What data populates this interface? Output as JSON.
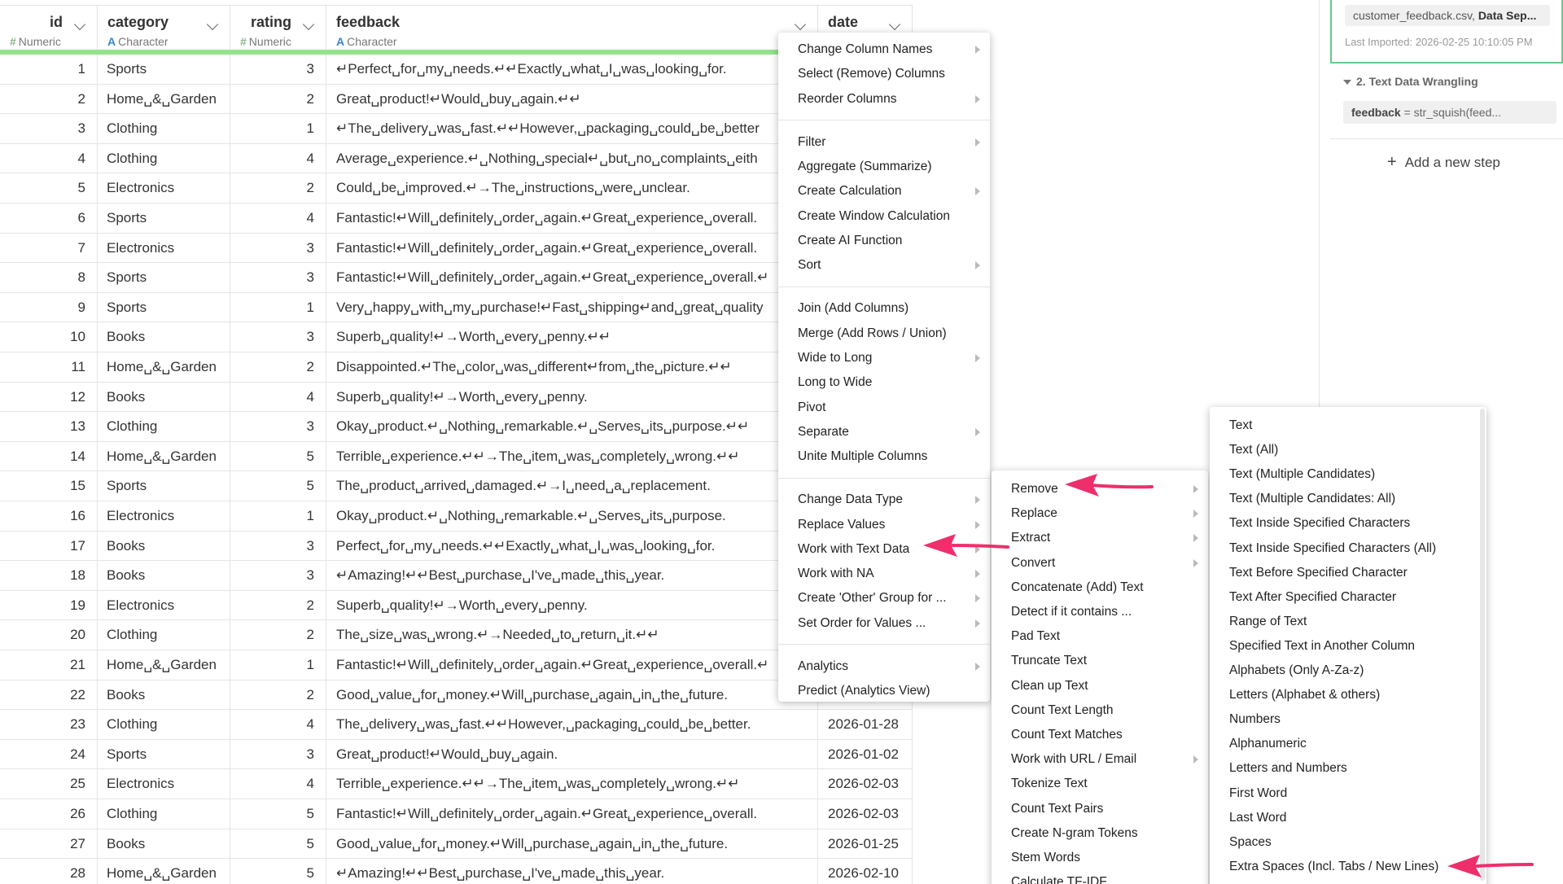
{
  "grid": {
    "columns": [
      {
        "name": "id",
        "type": "Numeric",
        "symbol": "#"
      },
      {
        "name": "category",
        "type": "Character",
        "symbol": "A"
      },
      {
        "name": "rating",
        "type": "Numeric",
        "symbol": "#"
      },
      {
        "name": "feedback",
        "type": "Character",
        "symbol": "A"
      },
      {
        "name": "date",
        "type": "",
        "symbol": ""
      }
    ],
    "rows": [
      {
        "id": "1",
        "category": "Sports",
        "rating": "3",
        "feedback": "↵Perfect␣for␣my␣needs.↵↵Exactly␣what␣I␣was␣looking␣for.",
        "date": ""
      },
      {
        "id": "2",
        "category": "Home␣&␣Garden",
        "rating": "2",
        "feedback": "Great␣product!↵Would␣buy␣again.↵↵",
        "date": ""
      },
      {
        "id": "3",
        "category": "Clothing",
        "rating": "1",
        "feedback": "↵The␣delivery␣was␣fast.↵↵However,␣packaging␣could␣be␣better",
        "date": ""
      },
      {
        "id": "4",
        "category": "Clothing",
        "rating": "4",
        "feedback": "Average␣experience.↵␣Nothing␣special↵␣but␣no␣complaints␣eith",
        "date": ""
      },
      {
        "id": "5",
        "category": "Electronics",
        "rating": "2",
        "feedback": "Could␣be␣improved.↵→The␣instructions␣were␣unclear.",
        "date": ""
      },
      {
        "id": "6",
        "category": "Sports",
        "rating": "4",
        "feedback": "Fantastic!↵Will␣definitely␣order␣again.↵Great␣experience␣overall.",
        "date": ""
      },
      {
        "id": "7",
        "category": "Electronics",
        "rating": "3",
        "feedback": "Fantastic!↵Will␣definitely␣order␣again.↵Great␣experience␣overall.",
        "date": ""
      },
      {
        "id": "8",
        "category": "Sports",
        "rating": "3",
        "feedback": "Fantastic!↵Will␣definitely␣order␣again.↵Great␣experience␣overall.↵",
        "date": ""
      },
      {
        "id": "9",
        "category": "Sports",
        "rating": "1",
        "feedback": "Very␣happy␣with␣my␣purchase!↵Fast␣shipping↵and␣great␣quality",
        "date": ""
      },
      {
        "id": "10",
        "category": "Books",
        "rating": "3",
        "feedback": "Superb␣quality!↵→Worth␣every␣penny.↵↵",
        "date": ""
      },
      {
        "id": "11",
        "category": "Home␣&␣Garden",
        "rating": "2",
        "feedback": "Disappointed.↵The␣color␣was␣different↵from␣the␣picture.↵↵",
        "date": ""
      },
      {
        "id": "12",
        "category": "Books",
        "rating": "4",
        "feedback": "Superb␣quality!↵→Worth␣every␣penny.",
        "date": ""
      },
      {
        "id": "13",
        "category": "Clothing",
        "rating": "3",
        "feedback": "Okay␣product.↵␣Nothing␣remarkable.↵␣Serves␣its␣purpose.↵↵",
        "date": ""
      },
      {
        "id": "14",
        "category": "Home␣&␣Garden",
        "rating": "5",
        "feedback": "Terrible␣experience.↵↵→The␣item␣was␣completely␣wrong.↵↵",
        "date": ""
      },
      {
        "id": "15",
        "category": "Sports",
        "rating": "5",
        "feedback": "The␣product␣arrived␣damaged.↵→I␣need␣a␣replacement.",
        "date": ""
      },
      {
        "id": "16",
        "category": "Electronics",
        "rating": "1",
        "feedback": "Okay␣product.↵␣Nothing␣remarkable.↵␣Serves␣its␣purpose.",
        "date": ""
      },
      {
        "id": "17",
        "category": "Books",
        "rating": "3",
        "feedback": "Perfect␣for␣my␣needs.↵↵Exactly␣what␣I␣was␣looking␣for.",
        "date": ""
      },
      {
        "id": "18",
        "category": "Books",
        "rating": "3",
        "feedback": "↵Amazing!↵↵Best␣purchase␣I've␣made␣this␣year.",
        "date": ""
      },
      {
        "id": "19",
        "category": "Electronics",
        "rating": "2",
        "feedback": "Superb␣quality!↵→Worth␣every␣penny.",
        "date": ""
      },
      {
        "id": "20",
        "category": "Clothing",
        "rating": "2",
        "feedback": "The␣size␣was␣wrong.↵→Needed␣to␣return␣it.↵↵",
        "date": ""
      },
      {
        "id": "21",
        "category": "Home␣&␣Garden",
        "rating": "1",
        "feedback": "Fantastic!↵Will␣definitely␣order␣again.↵Great␣experience␣overall.↵",
        "date": ""
      },
      {
        "id": "22",
        "category": "Books",
        "rating": "2",
        "feedback": "Good␣value␣for␣money.↵Will␣purchase␣again␣in␣the␣future.",
        "date": ""
      },
      {
        "id": "23",
        "category": "Clothing",
        "rating": "4",
        "feedback": "The␣delivery␣was␣fast.↵↵However,␣packaging␣could␣be␣better.",
        "date": "2026-01-28"
      },
      {
        "id": "24",
        "category": "Sports",
        "rating": "3",
        "feedback": "Great␣product!↵Would␣buy␣again.",
        "date": "2026-01-02"
      },
      {
        "id": "25",
        "category": "Electronics",
        "rating": "4",
        "feedback": "Terrible␣experience.↵↵→The␣item␣was␣completely␣wrong.↵↵",
        "date": "2026-02-03"
      },
      {
        "id": "26",
        "category": "Clothing",
        "rating": "5",
        "feedback": "Fantastic!↵Will␣definitely␣order␣again.↵Great␣experience␣overall.",
        "date": "2026-02-03"
      },
      {
        "id": "27",
        "category": "Books",
        "rating": "5",
        "feedback": "Good␣value␣for␣money.↵Will␣purchase␣again␣in␣the␣future.",
        "date": "2026-01-25"
      },
      {
        "id": "28",
        "category": "Home␣&␣Garden",
        "rating": "5",
        "feedback": "↵Amazing!↵↵Best␣purchase␣I've␣made␣this␣year.",
        "date": "2026-02-10"
      }
    ]
  },
  "panel": {
    "file_name": "customer_feedback.csv,",
    "file_suffix": "Data Sep...",
    "last_imported": "Last Imported: 2026-02-25 10:10:05 PM",
    "step_title": "2. Text Data Wrangling",
    "step_chip_col": "feedback",
    "step_chip_expr": "= str_squish(feed...",
    "add_step": "Add a new step"
  },
  "menu1": {
    "items": [
      {
        "label": "Change Column Names",
        "submenu": true
      },
      {
        "label": "Select (Remove) Columns",
        "submenu": false
      },
      {
        "label": "Reorder Columns",
        "submenu": true
      },
      {
        "sep": true
      },
      {
        "label": "Filter",
        "submenu": true
      },
      {
        "label": "Aggregate (Summarize)",
        "submenu": false
      },
      {
        "label": "Create Calculation",
        "submenu": true
      },
      {
        "label": "Create Window Calculation",
        "submenu": false
      },
      {
        "label": "Create AI Function",
        "submenu": false
      },
      {
        "label": "Sort",
        "submenu": true
      },
      {
        "sep": true
      },
      {
        "label": "Join (Add Columns)",
        "submenu": false
      },
      {
        "label": "Merge (Add Rows / Union)",
        "submenu": false
      },
      {
        "label": "Wide to Long",
        "submenu": true
      },
      {
        "label": "Long to Wide",
        "submenu": false
      },
      {
        "label": "Pivot",
        "submenu": false
      },
      {
        "label": "Separate",
        "submenu": true
      },
      {
        "label": "Unite Multiple Columns",
        "submenu": false
      },
      {
        "sep": true
      },
      {
        "label": "Change Data Type",
        "submenu": true
      },
      {
        "label": "Replace Values",
        "submenu": true
      },
      {
        "label": "Work with Text Data",
        "submenu": true
      },
      {
        "label": "Work with NA",
        "submenu": true
      },
      {
        "label": "Create 'Other' Group for ...",
        "submenu": true
      },
      {
        "label": "Set Order for Values ...",
        "submenu": true
      },
      {
        "sep": true
      },
      {
        "label": "Analytics",
        "submenu": true
      },
      {
        "label": "Predict (Analytics View)",
        "submenu": false
      }
    ]
  },
  "menu2": {
    "items": [
      {
        "label": "Remove",
        "submenu": true
      },
      {
        "label": "Replace",
        "submenu": true
      },
      {
        "label": "Extract",
        "submenu": true
      },
      {
        "label": "Convert",
        "submenu": true
      },
      {
        "label": "Concatenate (Add) Text",
        "submenu": false
      },
      {
        "label": "Detect if it contains ...",
        "submenu": false
      },
      {
        "label": "Pad Text",
        "submenu": false
      },
      {
        "label": "Truncate Text",
        "submenu": false
      },
      {
        "label": "Clean up Text",
        "submenu": false
      },
      {
        "label": "Count Text Length",
        "submenu": false
      },
      {
        "label": "Count Text Matches",
        "submenu": false
      },
      {
        "label": "Work with URL / Email",
        "submenu": true
      },
      {
        "label": "Tokenize Text",
        "submenu": false
      },
      {
        "label": "Count Text Pairs",
        "submenu": false
      },
      {
        "label": "Create N-gram Tokens",
        "submenu": false
      },
      {
        "label": "Stem Words",
        "submenu": false
      },
      {
        "label": "Calculate TF-IDF",
        "submenu": false
      }
    ]
  },
  "menu3": {
    "items": [
      {
        "label": "Text"
      },
      {
        "label": "Text (All)"
      },
      {
        "label": "Text (Multiple Candidates)"
      },
      {
        "label": "Text (Multiple Candidates: All)"
      },
      {
        "label": "Text Inside Specified Characters"
      },
      {
        "label": "Text Inside Specified Characters (All)"
      },
      {
        "label": "Text Before Specified Character"
      },
      {
        "label": "Text After Specified Character"
      },
      {
        "label": "Range of Text"
      },
      {
        "label": "Specified Text in Another Column"
      },
      {
        "label": "Alphabets (Only A-Za-z)"
      },
      {
        "label": "Letters (Alphabet & others)"
      },
      {
        "label": "Numbers"
      },
      {
        "label": "Alphanumeric"
      },
      {
        "label": "Letters and Numbers"
      },
      {
        "label": "First Word"
      },
      {
        "label": "Last Word"
      },
      {
        "label": "Spaces"
      },
      {
        "label": "Extra Spaces (Incl. Tabs / New Lines)"
      }
    ]
  },
  "colors": {
    "accent_green": "#67c98a",
    "header_bar_green": "#93e28c",
    "arrow_pink": "#ee2f6c",
    "numeric_icon": "#8ab28c",
    "character_icon": "#3a86c8"
  }
}
